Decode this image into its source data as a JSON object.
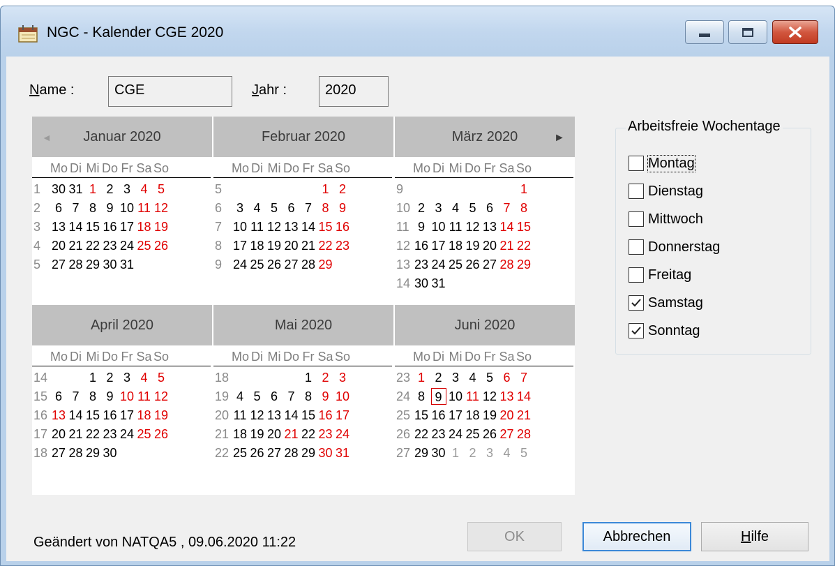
{
  "window": {
    "title": "NGC - Kalender CGE 2020",
    "icon": "calendar-icon"
  },
  "form": {
    "name_label_u": "N",
    "name_label_rest": "ame :",
    "name_value": "CGE",
    "year_label_u": "J",
    "year_label_rest": "ahr :",
    "year_value": "2020"
  },
  "weekday_headers": [
    "Mo",
    "Di",
    "Mi",
    "Do",
    "Fr",
    "Sa",
    "So"
  ],
  "months": [
    {
      "title": "Januar 2020",
      "weeks": [
        {
          "wk": "1",
          "days": [
            {
              "d": "30",
              "c": "n"
            },
            {
              "d": "31",
              "c": "n"
            },
            {
              "d": "1",
              "c": "we"
            },
            {
              "d": "2",
              "c": "n"
            },
            {
              "d": "3",
              "c": "n"
            },
            {
              "d": "4",
              "c": "we"
            },
            {
              "d": "5",
              "c": "we"
            }
          ]
        },
        {
          "wk": "2",
          "days": [
            {
              "d": "6",
              "c": "n"
            },
            {
              "d": "7",
              "c": "n"
            },
            {
              "d": "8",
              "c": "n"
            },
            {
              "d": "9",
              "c": "n"
            },
            {
              "d": "10",
              "c": "n"
            },
            {
              "d": "11",
              "c": "we"
            },
            {
              "d": "12",
              "c": "we"
            }
          ]
        },
        {
          "wk": "3",
          "days": [
            {
              "d": "13",
              "c": "n"
            },
            {
              "d": "14",
              "c": "n"
            },
            {
              "d": "15",
              "c": "n"
            },
            {
              "d": "16",
              "c": "n"
            },
            {
              "d": "17",
              "c": "n"
            },
            {
              "d": "18",
              "c": "we"
            },
            {
              "d": "19",
              "c": "we"
            }
          ]
        },
        {
          "wk": "4",
          "days": [
            {
              "d": "20",
              "c": "n"
            },
            {
              "d": "21",
              "c": "n"
            },
            {
              "d": "22",
              "c": "n"
            },
            {
              "d": "23",
              "c": "n"
            },
            {
              "d": "24",
              "c": "n"
            },
            {
              "d": "25",
              "c": "we"
            },
            {
              "d": "26",
              "c": "we"
            }
          ]
        },
        {
          "wk": "5",
          "days": [
            {
              "d": "27",
              "c": "n"
            },
            {
              "d": "28",
              "c": "n"
            },
            {
              "d": "29",
              "c": "n"
            },
            {
              "d": "30",
              "c": "n"
            },
            {
              "d": "31",
              "c": "n"
            },
            null,
            null
          ]
        }
      ]
    },
    {
      "title": "Februar 2020",
      "weeks": [
        {
          "wk": "5",
          "days": [
            null,
            null,
            null,
            null,
            null,
            {
              "d": "1",
              "c": "we"
            },
            {
              "d": "2",
              "c": "we"
            }
          ]
        },
        {
          "wk": "6",
          "days": [
            {
              "d": "3",
              "c": "n"
            },
            {
              "d": "4",
              "c": "n"
            },
            {
              "d": "5",
              "c": "n"
            },
            {
              "d": "6",
              "c": "n"
            },
            {
              "d": "7",
              "c": "n"
            },
            {
              "d": "8",
              "c": "we"
            },
            {
              "d": "9",
              "c": "we"
            }
          ]
        },
        {
          "wk": "7",
          "days": [
            {
              "d": "10",
              "c": "n"
            },
            {
              "d": "11",
              "c": "n"
            },
            {
              "d": "12",
              "c": "n"
            },
            {
              "d": "13",
              "c": "n"
            },
            {
              "d": "14",
              "c": "n"
            },
            {
              "d": "15",
              "c": "we"
            },
            {
              "d": "16",
              "c": "we"
            }
          ]
        },
        {
          "wk": "8",
          "days": [
            {
              "d": "17",
              "c": "n"
            },
            {
              "d": "18",
              "c": "n"
            },
            {
              "d": "19",
              "c": "n"
            },
            {
              "d": "20",
              "c": "n"
            },
            {
              "d": "21",
              "c": "n"
            },
            {
              "d": "22",
              "c": "we"
            },
            {
              "d": "23",
              "c": "we"
            }
          ]
        },
        {
          "wk": "9",
          "days": [
            {
              "d": "24",
              "c": "n"
            },
            {
              "d": "25",
              "c": "n"
            },
            {
              "d": "26",
              "c": "n"
            },
            {
              "d": "27",
              "c": "n"
            },
            {
              "d": "28",
              "c": "n"
            },
            {
              "d": "29",
              "c": "we"
            },
            null
          ]
        }
      ]
    },
    {
      "title": "März 2020",
      "weeks": [
        {
          "wk": "9",
          "days": [
            null,
            null,
            null,
            null,
            null,
            null,
            {
              "d": "1",
              "c": "we"
            }
          ]
        },
        {
          "wk": "10",
          "days": [
            {
              "d": "2",
              "c": "n"
            },
            {
              "d": "3",
              "c": "n"
            },
            {
              "d": "4",
              "c": "n"
            },
            {
              "d": "5",
              "c": "n"
            },
            {
              "d": "6",
              "c": "n"
            },
            {
              "d": "7",
              "c": "we"
            },
            {
              "d": "8",
              "c": "we"
            }
          ]
        },
        {
          "wk": "11",
          "days": [
            {
              "d": "9",
              "c": "n"
            },
            {
              "d": "10",
              "c": "n"
            },
            {
              "d": "11",
              "c": "n"
            },
            {
              "d": "12",
              "c": "n"
            },
            {
              "d": "13",
              "c": "n"
            },
            {
              "d": "14",
              "c": "we"
            },
            {
              "d": "15",
              "c": "we"
            }
          ]
        },
        {
          "wk": "12",
          "days": [
            {
              "d": "16",
              "c": "n"
            },
            {
              "d": "17",
              "c": "n"
            },
            {
              "d": "18",
              "c": "n"
            },
            {
              "d": "19",
              "c": "n"
            },
            {
              "d": "20",
              "c": "n"
            },
            {
              "d": "21",
              "c": "we"
            },
            {
              "d": "22",
              "c": "we"
            }
          ]
        },
        {
          "wk": "13",
          "days": [
            {
              "d": "23",
              "c": "n"
            },
            {
              "d": "24",
              "c": "n"
            },
            {
              "d": "25",
              "c": "n"
            },
            {
              "d": "26",
              "c": "n"
            },
            {
              "d": "27",
              "c": "n"
            },
            {
              "d": "28",
              "c": "we"
            },
            {
              "d": "29",
              "c": "we"
            }
          ]
        },
        {
          "wk": "14",
          "days": [
            {
              "d": "30",
              "c": "n"
            },
            {
              "d": "31",
              "c": "n"
            },
            null,
            null,
            null,
            null,
            null
          ]
        }
      ]
    },
    {
      "title": "April 2020",
      "weeks": [
        {
          "wk": "14",
          "days": [
            null,
            null,
            {
              "d": "1",
              "c": "n"
            },
            {
              "d": "2",
              "c": "n"
            },
            {
              "d": "3",
              "c": "n"
            },
            {
              "d": "4",
              "c": "we"
            },
            {
              "d": "5",
              "c": "we"
            }
          ]
        },
        {
          "wk": "15",
          "days": [
            {
              "d": "6",
              "c": "n"
            },
            {
              "d": "7",
              "c": "n"
            },
            {
              "d": "8",
              "c": "n"
            },
            {
              "d": "9",
              "c": "n"
            },
            {
              "d": "10",
              "c": "we"
            },
            {
              "d": "11",
              "c": "we"
            },
            {
              "d": "12",
              "c": "we"
            }
          ]
        },
        {
          "wk": "16",
          "days": [
            {
              "d": "13",
              "c": "we"
            },
            {
              "d": "14",
              "c": "n"
            },
            {
              "d": "15",
              "c": "n"
            },
            {
              "d": "16",
              "c": "n"
            },
            {
              "d": "17",
              "c": "n"
            },
            {
              "d": "18",
              "c": "we"
            },
            {
              "d": "19",
              "c": "we"
            }
          ]
        },
        {
          "wk": "17",
          "days": [
            {
              "d": "20",
              "c": "n"
            },
            {
              "d": "21",
              "c": "n"
            },
            {
              "d": "22",
              "c": "n"
            },
            {
              "d": "23",
              "c": "n"
            },
            {
              "d": "24",
              "c": "n"
            },
            {
              "d": "25",
              "c": "we"
            },
            {
              "d": "26",
              "c": "we"
            }
          ]
        },
        {
          "wk": "18",
          "days": [
            {
              "d": "27",
              "c": "n"
            },
            {
              "d": "28",
              "c": "n"
            },
            {
              "d": "29",
              "c": "n"
            },
            {
              "d": "30",
              "c": "n"
            },
            null,
            null,
            null
          ]
        }
      ]
    },
    {
      "title": "Mai 2020",
      "weeks": [
        {
          "wk": "18",
          "days": [
            null,
            null,
            null,
            null,
            {
              "d": "1",
              "c": "n"
            },
            {
              "d": "2",
              "c": "we"
            },
            {
              "d": "3",
              "c": "we"
            }
          ]
        },
        {
          "wk": "19",
          "days": [
            {
              "d": "4",
              "c": "n"
            },
            {
              "d": "5",
              "c": "n"
            },
            {
              "d": "6",
              "c": "n"
            },
            {
              "d": "7",
              "c": "n"
            },
            {
              "d": "8",
              "c": "n"
            },
            {
              "d": "9",
              "c": "we"
            },
            {
              "d": "10",
              "c": "we"
            }
          ]
        },
        {
          "wk": "20",
          "days": [
            {
              "d": "11",
              "c": "n"
            },
            {
              "d": "12",
              "c": "n"
            },
            {
              "d": "13",
              "c": "n"
            },
            {
              "d": "14",
              "c": "n"
            },
            {
              "d": "15",
              "c": "n"
            },
            {
              "d": "16",
              "c": "we"
            },
            {
              "d": "17",
              "c": "we"
            }
          ]
        },
        {
          "wk": "21",
          "days": [
            {
              "d": "18",
              "c": "n"
            },
            {
              "d": "19",
              "c": "n"
            },
            {
              "d": "20",
              "c": "n"
            },
            {
              "d": "21",
              "c": "we"
            },
            {
              "d": "22",
              "c": "n"
            },
            {
              "d": "23",
              "c": "we"
            },
            {
              "d": "24",
              "c": "we"
            }
          ]
        },
        {
          "wk": "22",
          "days": [
            {
              "d": "25",
              "c": "n"
            },
            {
              "d": "26",
              "c": "n"
            },
            {
              "d": "27",
              "c": "n"
            },
            {
              "d": "28",
              "c": "n"
            },
            {
              "d": "29",
              "c": "n"
            },
            {
              "d": "30",
              "c": "we"
            },
            {
              "d": "31",
              "c": "we"
            }
          ]
        }
      ]
    },
    {
      "title": "Juni 2020",
      "weeks": [
        {
          "wk": "23",
          "days": [
            {
              "d": "1",
              "c": "we"
            },
            {
              "d": "2",
              "c": "n"
            },
            {
              "d": "3",
              "c": "n"
            },
            {
              "d": "4",
              "c": "n"
            },
            {
              "d": "5",
              "c": "n"
            },
            {
              "d": "6",
              "c": "we"
            },
            {
              "d": "7",
              "c": "we"
            }
          ]
        },
        {
          "wk": "24",
          "days": [
            {
              "d": "8",
              "c": "n"
            },
            {
              "d": "9",
              "c": "today"
            },
            {
              "d": "10",
              "c": "n"
            },
            {
              "d": "11",
              "c": "we"
            },
            {
              "d": "12",
              "c": "n"
            },
            {
              "d": "13",
              "c": "we"
            },
            {
              "d": "14",
              "c": "we"
            }
          ]
        },
        {
          "wk": "25",
          "days": [
            {
              "d": "15",
              "c": "n"
            },
            {
              "d": "16",
              "c": "n"
            },
            {
              "d": "17",
              "c": "n"
            },
            {
              "d": "18",
              "c": "n"
            },
            {
              "d": "19",
              "c": "n"
            },
            {
              "d": "20",
              "c": "we"
            },
            {
              "d": "21",
              "c": "we"
            }
          ]
        },
        {
          "wk": "26",
          "days": [
            {
              "d": "22",
              "c": "n"
            },
            {
              "d": "23",
              "c": "n"
            },
            {
              "d": "24",
              "c": "n"
            },
            {
              "d": "25",
              "c": "n"
            },
            {
              "d": "26",
              "c": "n"
            },
            {
              "d": "27",
              "c": "we"
            },
            {
              "d": "28",
              "c": "we"
            }
          ]
        },
        {
          "wk": "27",
          "days": [
            {
              "d": "29",
              "c": "n"
            },
            {
              "d": "30",
              "c": "n"
            },
            {
              "d": "1",
              "c": "ot"
            },
            {
              "d": "2",
              "c": "ot"
            },
            {
              "d": "3",
              "c": "ot"
            },
            {
              "d": "4",
              "c": "ot"
            },
            {
              "d": "5",
              "c": "ot"
            }
          ]
        }
      ]
    }
  ],
  "workfree": {
    "title": "Arbeitsfreie Wochentage",
    "items": [
      {
        "label": "Montag",
        "checked": false
      },
      {
        "label": "Dienstag",
        "checked": false
      },
      {
        "label": "Mittwoch",
        "checked": false
      },
      {
        "label": "Donnerstag",
        "checked": false
      },
      {
        "label": "Freitag",
        "checked": false
      },
      {
        "label": "Samstag",
        "checked": true
      },
      {
        "label": "Sonntag",
        "checked": true
      }
    ]
  },
  "buttons": {
    "ok": "OK",
    "cancel": "Abbrechen",
    "help_u": "H",
    "help_rest": "ilfe"
  },
  "status": "Geändert von NATQA5 , 09.06.2020 11:22",
  "colors": {
    "weekend": "#e00000",
    "today_border": "#d40000",
    "header_bg": "#c0c0c0",
    "frame": "#b9d1ea"
  }
}
